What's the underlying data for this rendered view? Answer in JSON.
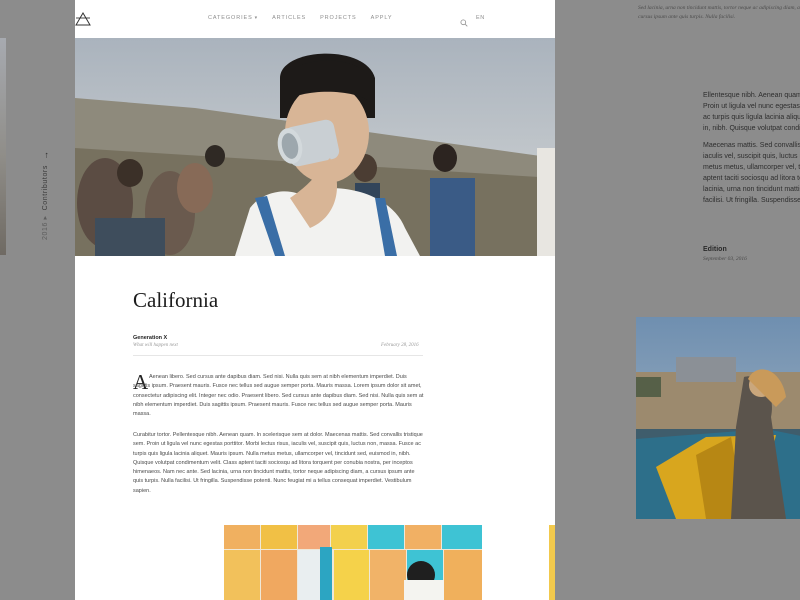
{
  "colors": {
    "card_bg": "#ffffff",
    "overlay": "#8c8c8c",
    "nav_text": "#8e8e8e",
    "body_text": "#4a4a4a"
  },
  "left": {
    "crumb_year": "2016 ▸",
    "crumb_label": "Contributors",
    "crumb_arrow_icon": "arrow-right-icon"
  },
  "header": {
    "logo_icon": "triangle-logo-icon",
    "nav": [
      {
        "label": "CATEGORIES",
        "has_dropdown": true
      },
      {
        "label": "ARTICLES"
      },
      {
        "label": "PROJECTS"
      },
      {
        "label": "APPLY"
      }
    ],
    "search_icon": "search-icon",
    "language": "EN"
  },
  "article": {
    "title": "California",
    "category": "Generation X",
    "subtitle": "What will happen next",
    "date": "February 28, 2016",
    "dropcap": "A",
    "paragraph1": "Aenean libero. Sed cursus ante dapibus diam. Sed nisi. Nulla quis sem at nibh elementum imperdiet. Duis sagittis ipsum. Praesent mauris. Fusce nec tellus sed augue semper porta. Mauris massa. Lorem ipsum dolor sit amet, consectetur adipiscing elit. Integer nec odio. Praesent libero. Sed cursus ante dapibus diam. Sed nisi. Nulla quis sem at nibh elementum imperdiet. Duis sagittis ipsum. Praesent mauris. Fusce nec tellus sed augue semper porta. Mauris massa.",
    "paragraph2": "Curabitur tortor. Pellentesque nibh. Aenean quam. In scelerisque sem at dolor. Maecenas mattis. Sed convallis tristique sem. Proin ut ligula vel nunc egestas porttitor. Morbi lectus risus, iaculis vel, suscipit quis, luctus non, massa. Fusce ac turpis quis ligula lacinia aliquet. Mauris ipsum. Nulla metus metus, ullamcorper vel, tincidunt sed, euismod in, nibh. Quisque volutpat condimentum velit. Class aptent taciti sociosqu ad litora torquent per conubia nostra, per inceptos himenaeos. Nam nec ante. Sed lacinia, urna non tincidunt mattis, tortor neque adipiscing diam, a cursus ipsum ante quis turpis. Nulla facilisi. Ut fringilla. Suspendisse potenti. Nunc feugiat mi a tellus consequat imperdiet. Vestibulum sapien."
  },
  "right": {
    "top_text": "Sed lacinia, urna non tincidunt mattis, tortor neque ac adipiscing diam, a cursus ipsum ante quis turpis. Nulla facilisi.",
    "para1": [
      "Ellentesque nibh. Aenean quam. In",
      "Proin ut ligula vel nunc egestas po",
      "ac turpis quis ligula lacinia aliquet",
      "in, nibh. Quisque volutpat condim"
    ],
    "para2": [
      "Maecenas mattis. Sed convallis tris",
      "iaculis vel, suscipit quis, luctus no",
      "metus metus, ullamcorper vel, tinc",
      "aptent taciti sociosqu ad litora tor",
      "lacinia, urna non tincidunt mattis,",
      "facilisi. Ut fringilla. Suspendisse p"
    ],
    "edition_label": "Edition",
    "edition_date": "September 03, 2016"
  }
}
